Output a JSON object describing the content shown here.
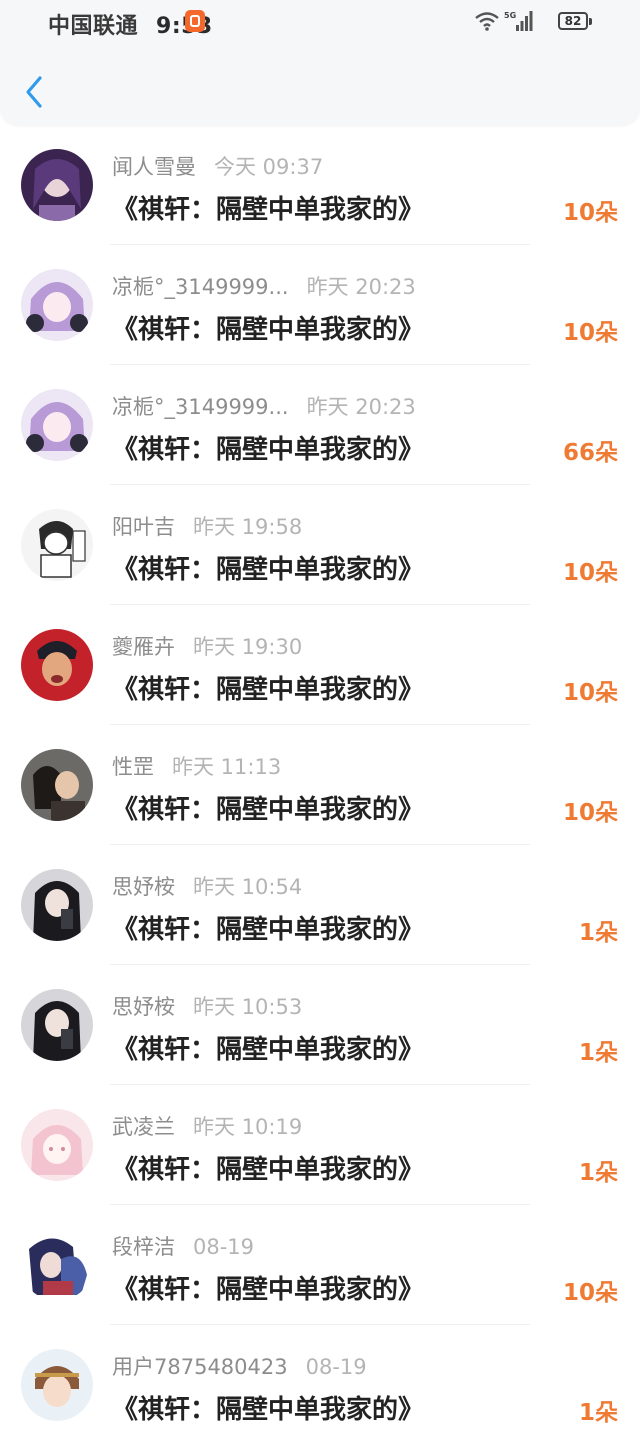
{
  "status_bar": {
    "carrier": "中国联通",
    "time": "9:53",
    "network": "5G",
    "battery": "82"
  },
  "nav": {
    "back_icon": "chevron-left-icon"
  },
  "colors": {
    "amount": "#ee7a33",
    "back": "#2f9bef"
  },
  "items": [
    {
      "name": "闻人雪曼",
      "time": "今天 09:37",
      "title": "《祺轩：隔壁中单我家的》",
      "amount": "10朵",
      "avatar": "purple-anime-girl"
    },
    {
      "name": "凉栀°_3149999...",
      "time": "昨天 20:23",
      "title": "《祺轩：隔壁中单我家的》",
      "amount": "10朵",
      "avatar": "lavender-anime-girl"
    },
    {
      "name": "凉栀°_3149999...",
      "time": "昨天 20:23",
      "title": "《祺轩：隔壁中单我家的》",
      "amount": "66朵",
      "avatar": "lavender-anime-girl"
    },
    {
      "name": "阳叶吉",
      "time": "昨天 19:58",
      "title": "《祺轩：隔壁中单我家的》",
      "amount": "10朵",
      "avatar": "sketch-doodle"
    },
    {
      "name": "夔雁卉",
      "time": "昨天 19:30",
      "title": "《祺轩：隔壁中单我家的》",
      "amount": "10朵",
      "avatar": "red-portrait"
    },
    {
      "name": "性罡",
      "time": "昨天 11:13",
      "title": "《祺轩：隔壁中单我家的》",
      "amount": "10朵",
      "avatar": "couple-photo"
    },
    {
      "name": "思妤桉",
      "time": "昨天 10:54",
      "title": "《祺轩：隔壁中单我家的》",
      "amount": "1朵",
      "avatar": "girl-selfie"
    },
    {
      "name": "思妤桉",
      "time": "昨天 10:53",
      "title": "《祺轩：隔壁中单我家的》",
      "amount": "1朵",
      "avatar": "girl-selfie"
    },
    {
      "name": "武凌兰",
      "time": "昨天 10:19",
      "title": "《祺轩：隔壁中单我家的》",
      "amount": "1朵",
      "avatar": "pink-anime"
    },
    {
      "name": "段梓洁",
      "time": "08-19",
      "title": "《祺轩：隔壁中单我家的》",
      "amount": "10朵",
      "avatar": "dark-anime-couple"
    },
    {
      "name": "用户7875480423",
      "time": "08-19",
      "title": "《祺轩：隔壁中单我家的》",
      "amount": "1朵",
      "avatar": "anime-boy"
    }
  ]
}
